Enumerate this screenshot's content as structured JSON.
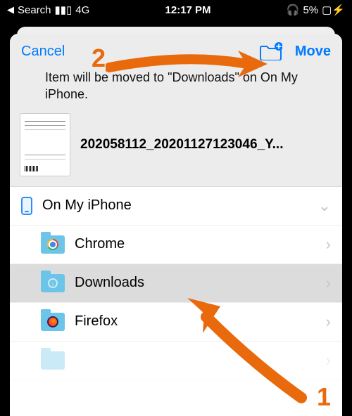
{
  "status": {
    "back": "Search",
    "signal": "4G",
    "time": "12:17 PM",
    "battery": "5%"
  },
  "nav": {
    "cancel": "Cancel",
    "move": "Move"
  },
  "msg": "Item will be moved to \"Downloads\" on On My iPhone.",
  "file_name": "202058112_20201127123046_Y...",
  "root": {
    "label": "On My iPhone"
  },
  "folders": [
    {
      "label": "Chrome",
      "kind": "chrome",
      "selected": false
    },
    {
      "label": "Downloads",
      "kind": "dl",
      "selected": true
    },
    {
      "label": "Firefox",
      "kind": "ff",
      "selected": false
    }
  ],
  "annotations": {
    "step1": "1",
    "step2": "2"
  },
  "colors": {
    "accent": "#007aff",
    "annotation": "#e86a0c"
  }
}
